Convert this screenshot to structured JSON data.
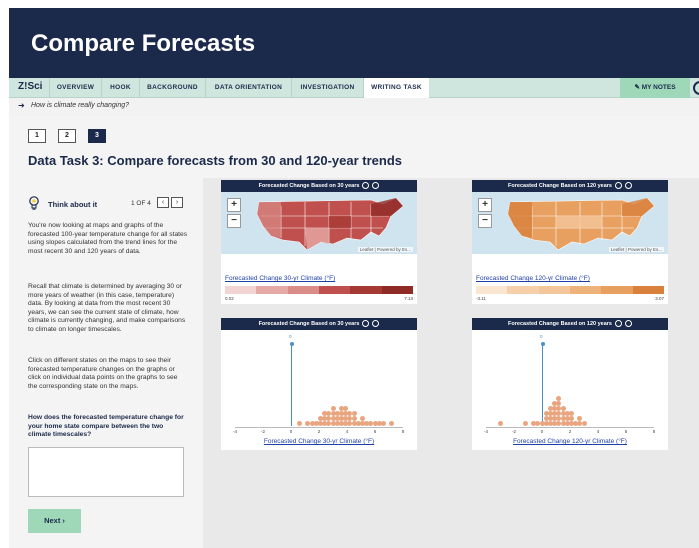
{
  "banner": {
    "title": "Compare Forecasts"
  },
  "nav": {
    "logo": "Z!Sci",
    "tabs": [
      "OVERVIEW",
      "HOOK",
      "BACKGROUND",
      "DATA ORIENTATION",
      "INVESTIGATION",
      "WRITING TASK"
    ],
    "notes": "✎ MY NOTES"
  },
  "breadcrumb": "How is climate really changing?",
  "steps": [
    "1",
    "2",
    "3"
  ],
  "task_title": "Data Task 3: Compare forecasts from 30 and 120-year trends",
  "left": {
    "think": "Think about it",
    "pager": "1 OF 4",
    "para1": "You're now looking at maps and graphs of the forecasted 100-year temperature change for all states using slopes calculated from the trend lines for the most recent 30 and 120 years of data.",
    "para2": "Recall that climate is determined by averaging 30 or more years of weather (in this case, temperature) data. By looking at data from the most recent 30 years, we can see the current state of climate, how climate is currently changing, and make comparisons to climate on longer timescales.",
    "para3": "Click on different states on the maps to see their forecasted temperature changes on the graphs or click on individual data points on the graphs to see the corresponding state on the maps.",
    "question": "How does the forecasted temperature change for your home state compare between the two climate timescales?",
    "next": "Next ›"
  },
  "maps": [
    {
      "title": "Forecasted Change Based on 30 years",
      "legend": "Forecasted Change 30-yr Climate (°F)",
      "lo": "0.02",
      "hi": "7.13",
      "attrib": "Leaflet | Powered by Es..."
    },
    {
      "title": "Forecasted Change Based on 120 years",
      "legend": "Forecasted Change 120-yr Climate (°F)",
      "lo": "-3.11",
      "hi": "3.07",
      "attrib": "Leaflet | Powered by Es..."
    }
  ],
  "charts": [
    {
      "title": "Forecasted Change Based on 30 years",
      "label": "Forecasted Change 30-yr Climate (°F)",
      "zero_label": "0"
    },
    {
      "title": "Forecasted Change Based on 120 years",
      "label": "Forecasted Change 120-yr Climate (°F)",
      "zero_label": "0"
    }
  ],
  "axis_ticks": [
    "-4",
    "-2",
    "0",
    "2",
    "4",
    "6",
    "8"
  ],
  "colors": {
    "navy": "#1b2a4a",
    "accent": "#9ed8b9",
    "dot": "#e9a57f",
    "map30": "#c0504d",
    "map120": "#e8a060"
  },
  "chart_data": [
    {
      "type": "scatter",
      "xlabel": "Forecasted Change 30-yr Climate (°F)",
      "xlim": [
        -4,
        8
      ],
      "values": [
        0.5,
        1.2,
        1.6,
        1.8,
        2.0,
        2.1,
        2.3,
        2.4,
        2.5,
        2.6,
        2.7,
        2.8,
        2.9,
        3.0,
        3.0,
        3.1,
        3.2,
        3.3,
        3.4,
        3.5,
        3.5,
        3.6,
        3.7,
        3.8,
        3.9,
        4.0,
        4.0,
        4.1,
        4.2,
        4.3,
        4.4,
        4.5,
        4.6,
        4.8,
        5.0,
        5.2,
        5.5,
        5.8,
        6.1,
        6.4,
        6.7,
        7.1
      ]
    },
    {
      "type": "scatter",
      "xlabel": "Forecasted Change 120-yr Climate (°F)",
      "xlim": [
        -4,
        8
      ],
      "values": [
        -3.1,
        -1.2,
        -0.6,
        -0.3,
        0.0,
        0.2,
        0.3,
        0.4,
        0.5,
        0.6,
        0.6,
        0.7,
        0.8,
        0.8,
        0.9,
        1.0,
        1.0,
        1.1,
        1.1,
        1.2,
        1.2,
        1.3,
        1.3,
        1.4,
        1.5,
        1.5,
        1.6,
        1.7,
        1.8,
        1.9,
        2.0,
        2.1,
        2.2,
        2.4,
        2.6,
        2.8,
        3.0
      ]
    }
  ]
}
